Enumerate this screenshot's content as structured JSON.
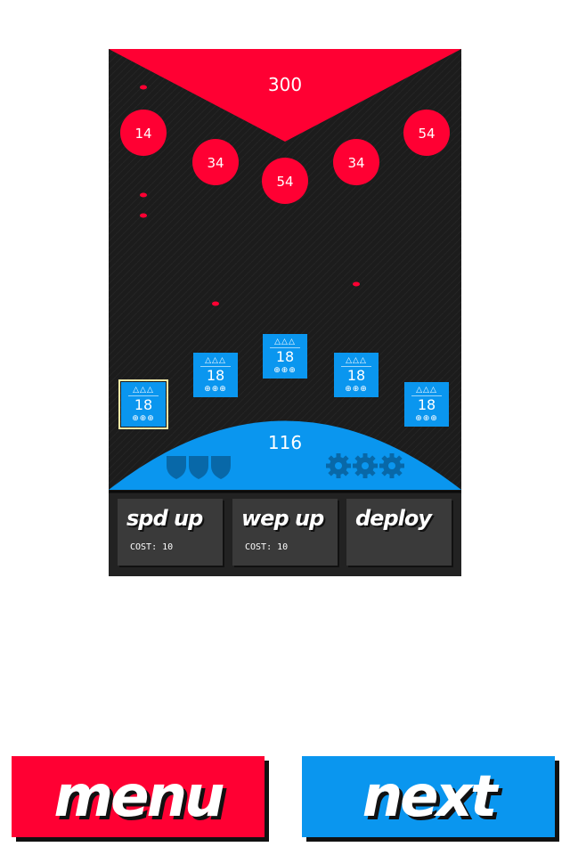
{
  "colors": {
    "enemy": "#ff0033",
    "player": "#0a96ef",
    "arena": "#1c1c1c",
    "panel": "#3a3a3a"
  },
  "enemy_base": {
    "hp": "300"
  },
  "enemies": [
    "14",
    "34",
    "54",
    "34",
    "54"
  ],
  "units": [
    {
      "rank": "△△△",
      "level": "18",
      "weapons": "⊕⊕⊕",
      "selected": true
    },
    {
      "rank": "△△△",
      "level": "18",
      "weapons": "⊕⊕⊕",
      "selected": false
    },
    {
      "rank": "△△△",
      "level": "18",
      "weapons": "⊕⊕⊕",
      "selected": false
    },
    {
      "rank": "△△△",
      "level": "18",
      "weapons": "⊕⊕⊕",
      "selected": false
    },
    {
      "rank": "△△△",
      "level": "18",
      "weapons": "⊕⊕⊕",
      "selected": false
    }
  ],
  "player_base": {
    "hp": "116",
    "shields": 3,
    "gears": 3,
    "shield_icon": "shield-icon",
    "gear_icon": "gear-icon"
  },
  "upgrades": [
    {
      "label": "spd up",
      "cost": "COST: 10"
    },
    {
      "label": "wep up",
      "cost": "COST: 10"
    },
    {
      "label": "deploy",
      "cost": ""
    }
  ],
  "nav": {
    "menu_label": "menu",
    "next_label": "next"
  }
}
